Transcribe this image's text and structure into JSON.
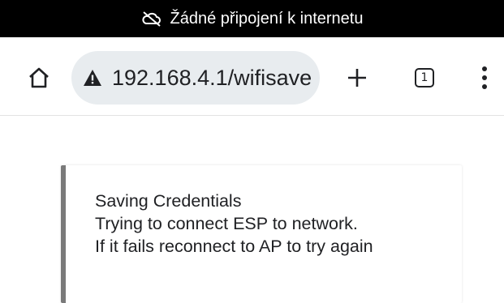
{
  "status_bar": {
    "icon": "cloud-off-icon",
    "text": "Žádné připojení k internetu"
  },
  "toolbar": {
    "home_icon": "home-icon",
    "security_icon": "warning-icon",
    "url": "192.168.4.1/wifisave",
    "new_tab_icon": "plus-icon",
    "tab_count": "1",
    "menu_icon": "more-vert-icon"
  },
  "message": {
    "lines": [
      "Saving Credentials",
      "Trying to connect ESP to network.",
      "If it fails reconnect to AP to try again"
    ]
  }
}
